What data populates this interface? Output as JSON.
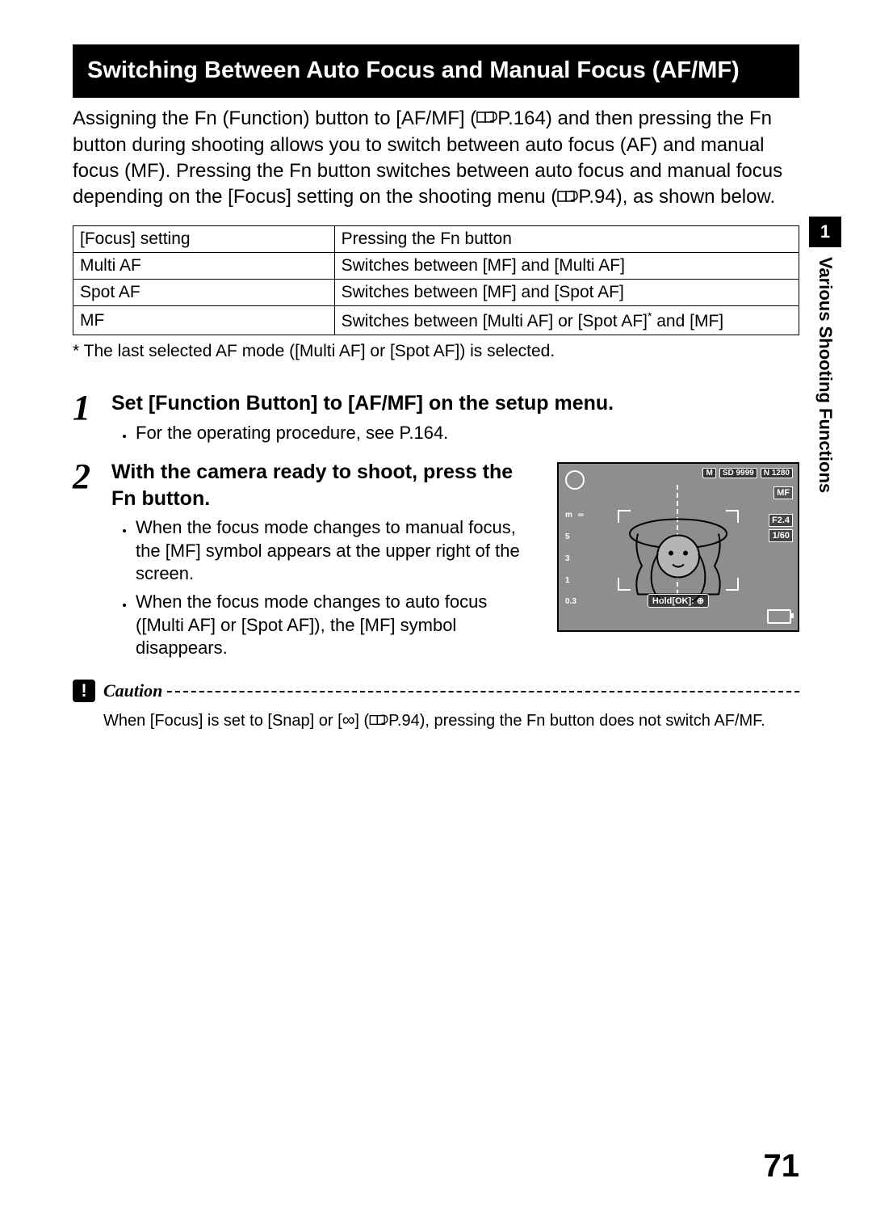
{
  "header": "Switching Between Auto Focus and Manual Focus (AF/MF)",
  "intro_pre": "Assigning the Fn (Function) button to [AF/MF] (",
  "intro_ref1": "P.164",
  "intro_mid": ") and then pressing the Fn button during shooting allows you to switch between auto focus (AF) and manual focus (MF). Pressing the Fn button switches between auto focus and manual focus depending on the [Focus] setting on the shooting menu (",
  "intro_ref2": "P.94",
  "intro_post": "), as shown below.",
  "table": {
    "head_focus": "[Focus] setting",
    "head_fn": "Pressing the Fn button",
    "rows": [
      {
        "focus": "Multi AF",
        "fn": "Switches between [MF] and [Multi AF]"
      },
      {
        "focus": "Spot AF",
        "fn": "Switches between [MF] and [Spot AF]"
      },
      {
        "focus": "MF",
        "fn_pre": "Switches between [Multi AF] or [Spot AF]",
        "fn_post": " and [MF]"
      }
    ]
  },
  "footnote": "* The last selected AF mode ([Multi AF] or [Spot AF]) is selected.",
  "steps": {
    "s1": {
      "num": "1",
      "title": "Set [Function Button] to [AF/MF] on the setup menu.",
      "bullets": [
        "For the operating procedure, see P.164."
      ]
    },
    "s2": {
      "num": "2",
      "title": "With the camera ready to shoot, press the Fn button.",
      "bullets": [
        "When the focus mode changes to manual focus, the [MF] symbol appears at the upper right of the screen.",
        "When the focus mode changes to auto focus ([Multi AF] or [Spot AF]), the [MF] symbol disappears."
      ]
    }
  },
  "lcd": {
    "mode": "M",
    "sd": "SD 9999",
    "quality": "N 1280",
    "mf": "MF",
    "aperture": "F2.4",
    "shutter": "1/60",
    "holdok": "Hold[OK]: ⊕",
    "gauge_top_m": "m",
    "gauge_inf": "∞",
    "gauge_5": "5",
    "gauge_3": "3",
    "gauge_1": "1",
    "gauge_03": "0.3"
  },
  "caution": {
    "label": "Caution",
    "text_pre": "When [Focus] is set to [Snap] or [",
    "text_inf": "∞",
    "text_mid": "] (",
    "text_ref": "P.94",
    "text_post": "), pressing the Fn button does not switch AF/MF."
  },
  "sidetab": {
    "num": "1",
    "text": "Various Shooting Functions"
  },
  "page_number": "71"
}
